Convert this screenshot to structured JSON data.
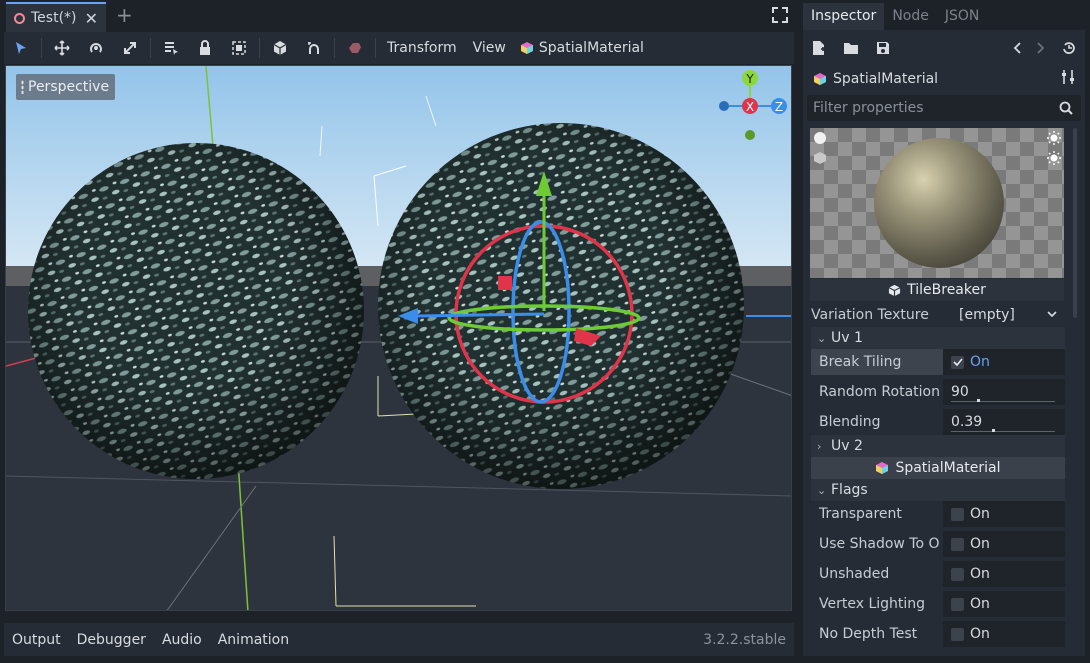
{
  "scene_tabs": {
    "active_tab": "Test(*)"
  },
  "toolbar": {
    "menus": [
      "Transform",
      "View"
    ],
    "material_label": "SpatialMaterial"
  },
  "viewport": {
    "perspective_label": "Perspective"
  },
  "gizmo": {
    "y": "Y",
    "x": "X",
    "z": "Z"
  },
  "bottom_panel": {
    "items": [
      "Output",
      "Debugger",
      "Audio",
      "Animation"
    ],
    "version": "3.2.2.stable"
  },
  "dock": {
    "tabs": [
      "Inspector",
      "Node",
      "JSON"
    ],
    "resource_name": "SpatialMaterial",
    "filter_placeholder": "Filter properties",
    "preview_script": "TileBreaker",
    "variation_texture": {
      "label": "Variation Texture",
      "value": "[empty]"
    },
    "uv1": {
      "title": "Uv 1",
      "break_tiling": {
        "label": "Break Tiling",
        "value": "On",
        "checked": true
      },
      "random_rotation": {
        "label": "Random Rotation",
        "value": "90",
        "fraction": 0.25
      },
      "blending": {
        "label": "Blending",
        "value": "0.39",
        "fraction": 0.39
      }
    },
    "uv2": {
      "title": "Uv 2"
    },
    "sub_resource": "SpatialMaterial",
    "flags": {
      "title": "Flags",
      "items": [
        {
          "label": "Transparent",
          "value": "On"
        },
        {
          "label": "Use Shadow To O",
          "value": "On"
        },
        {
          "label": "Unshaded",
          "value": "On"
        },
        {
          "label": "Vertex Lighting",
          "value": "On"
        },
        {
          "label": "No Depth Test",
          "value": "On"
        }
      ]
    }
  },
  "colors": {
    "accent": "#6ba2f2",
    "axis_x": "#e0344a",
    "axis_y": "#8cd83a",
    "axis_z": "#3a8de8"
  }
}
